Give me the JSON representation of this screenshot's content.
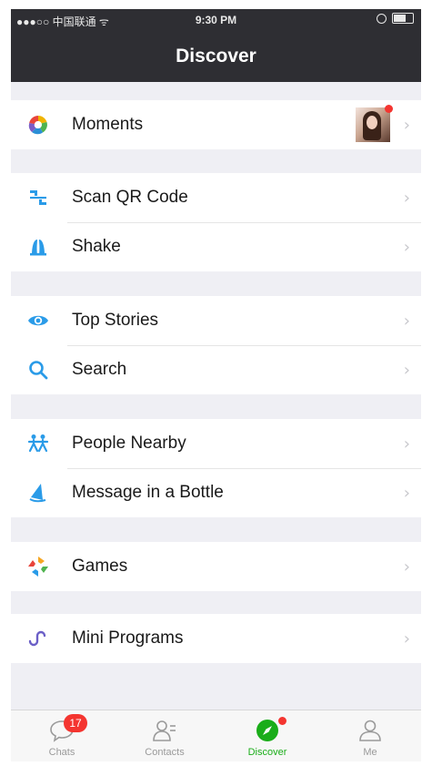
{
  "status_bar": {
    "carrier": "●●●○○ 中国联通 ᯤ",
    "time": "9:30 PM"
  },
  "nav": {
    "title": "Discover"
  },
  "groups": [
    {
      "items": [
        {
          "label": "Moments",
          "icon": "moments-icon",
          "has_avatar": true,
          "has_new_dot": true
        }
      ]
    },
    {
      "items": [
        {
          "label": "Scan QR Code",
          "icon": "scan-qr-code-icon"
        },
        {
          "label": "Shake",
          "icon": "shake-icon"
        }
      ]
    },
    {
      "items": [
        {
          "label": "Top Stories",
          "icon": "top-stories-eye-icon"
        },
        {
          "label": "Search",
          "icon": "search-icon"
        }
      ]
    },
    {
      "items": [
        {
          "label": "People Nearby",
          "icon": "people-nearby-icon"
        },
        {
          "label": "Message in a Bottle",
          "icon": "message-bottle-icon"
        }
      ]
    },
    {
      "items": [
        {
          "label": "Games",
          "icon": "games-icon"
        }
      ]
    },
    {
      "items": [
        {
          "label": "Mini Programs",
          "icon": "mini-programs-icon"
        }
      ]
    }
  ],
  "tabs": [
    {
      "label": "Chats",
      "icon": "chats-icon",
      "badge": "17",
      "active": false
    },
    {
      "label": "Contacts",
      "icon": "contacts-icon",
      "active": false
    },
    {
      "label": "Discover",
      "icon": "discover-compass-icon",
      "active": true
    },
    {
      "label": "Me",
      "icon": "me-icon",
      "active": false
    }
  ],
  "colors": {
    "nav_background": "#2e2e33",
    "page_background": "#efeff4",
    "accent_green": "#1aad19",
    "badge_red": "#f43530"
  }
}
